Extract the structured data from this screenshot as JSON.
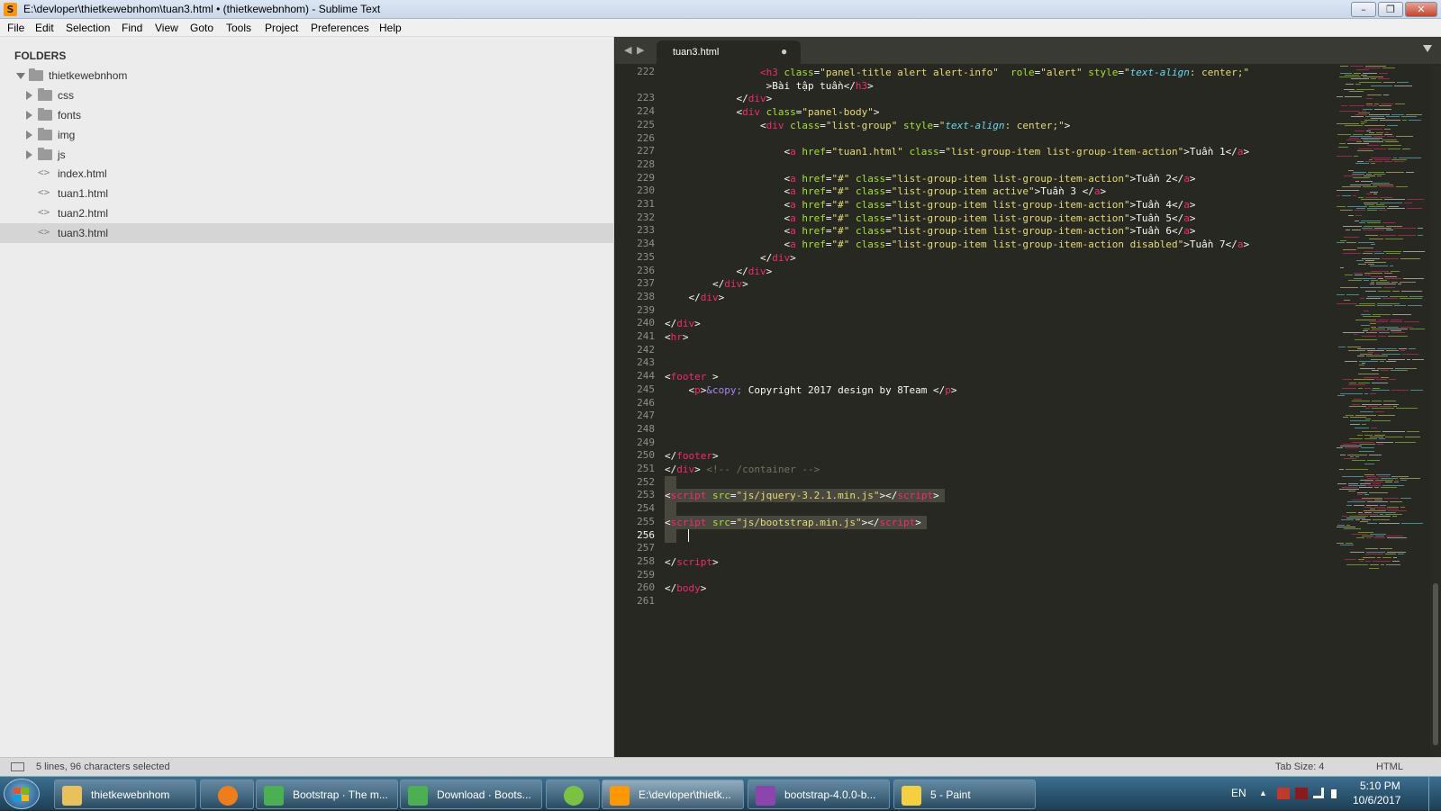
{
  "window": {
    "title": "E:\\devloper\\thietkewebnhom\\tuan3.html • (thietkewebnhom) - Sublime Text",
    "app_icon": "S",
    "minimize_icon": "–",
    "maximize_icon": "❐",
    "close_icon": "✕"
  },
  "menu": [
    "File",
    "Edit",
    "Selection",
    "Find",
    "View",
    "Goto",
    "Tools",
    "Project",
    "Preferences",
    "Help"
  ],
  "sidebar": {
    "header": "FOLDERS",
    "root": "thietkewebnhom",
    "folders": [
      "css",
      "fonts",
      "img",
      "js"
    ],
    "files": [
      "index.html",
      "tuan1.html",
      "tuan2.html",
      "tuan3.html"
    ],
    "selected_file": "tuan3.html",
    "file_icon": "<>"
  },
  "tabs": {
    "nav_left": "◀",
    "nav_right": "▶",
    "active": {
      "label": "tuan3.html",
      "dirty_marker": "●"
    }
  },
  "editor": {
    "current_line": 256,
    "lines": [
      {
        "n": 222,
        "html": "                <span class='t'>&lt;h3</span> <span class='a'>class</span>=<span class='s'>\"panel-title alert alert-info\"</span>  <span class='a'>role</span>=<span class='s'>\"alert\"</span> <span class='a'>style</span>=<span class='s'>\"<span class='i'>text-align</span>: center;\"</span>"
      },
      {
        "n": null,
        "html": "                 &gt;Bài tập tuần&lt;/<span class='t'>h3</span>&gt;"
      },
      {
        "n": 223,
        "html": "            &lt;/<span class='t'>div</span>&gt;"
      },
      {
        "n": 224,
        "html": "            &lt;<span class='t'>div</span> <span class='a'>class</span>=<span class='s'>\"panel-body\"</span>&gt;"
      },
      {
        "n": 225,
        "html": "                &lt;<span class='t'>div</span> <span class='a'>class</span>=<span class='s'>\"list-group\"</span> <span class='a'>style</span>=<span class='s'>\"<span class='i'>text-align</span>: center;\"</span>&gt;"
      },
      {
        "n": 226,
        "html": ""
      },
      {
        "n": 227,
        "html": "                    &lt;<span class='t'>a</span> <span class='a'>href</span>=<span class='s'>\"tuan1.html\"</span> <span class='a'>class</span>=<span class='s'>\"list-group-item list-group-item-action\"</span>&gt;Tuần 1&lt;/<span class='t'>a</span>&gt;"
      },
      {
        "n": 228,
        "html": ""
      },
      {
        "n": 229,
        "html": "                    &lt;<span class='t'>a</span> <span class='a'>href</span>=<span class='s'>\"#\"</span> <span class='a'>class</span>=<span class='s'>\"list-group-item list-group-item-action\"</span>&gt;Tuần 2&lt;/<span class='t'>a</span>&gt;"
      },
      {
        "n": 230,
        "html": "                    &lt;<span class='t'>a</span> <span class='a'>href</span>=<span class='s'>\"#\"</span> <span class='a'>class</span>=<span class='s'>\"list-group-item active\"</span>&gt;Tuần 3 &lt;/<span class='t'>a</span>&gt;"
      },
      {
        "n": 231,
        "html": "                    &lt;<span class='t'>a</span> <span class='a'>href</span>=<span class='s'>\"#\"</span> <span class='a'>class</span>=<span class='s'>\"list-group-item list-group-item-action\"</span>&gt;Tuần 4&lt;/<span class='t'>a</span>&gt;"
      },
      {
        "n": 232,
        "html": "                    &lt;<span class='t'>a</span> <span class='a'>href</span>=<span class='s'>\"#\"</span> <span class='a'>class</span>=<span class='s'>\"list-group-item list-group-item-action\"</span>&gt;Tuần 5&lt;/<span class='t'>a</span>&gt;"
      },
      {
        "n": 233,
        "html": "                    &lt;<span class='t'>a</span> <span class='a'>href</span>=<span class='s'>\"#\"</span> <span class='a'>class</span>=<span class='s'>\"list-group-item list-group-item-action\"</span>&gt;Tuần 6&lt;/<span class='t'>a</span>&gt;"
      },
      {
        "n": 234,
        "html": "                    &lt;<span class='t'>a</span> <span class='a'>href</span>=<span class='s'>\"#\"</span> <span class='a'>class</span>=<span class='s'>\"list-group-item list-group-item-action disabled\"</span>&gt;Tuần 7&lt;/<span class='t'>a</span>&gt;"
      },
      {
        "n": 235,
        "html": "                &lt;/<span class='t'>div</span>&gt;"
      },
      {
        "n": 236,
        "html": "            &lt;/<span class='t'>div</span>&gt;"
      },
      {
        "n": 237,
        "html": "        &lt;/<span class='t'>div</span>&gt;"
      },
      {
        "n": 238,
        "html": "    &lt;/<span class='t'>div</span>&gt;"
      },
      {
        "n": 239,
        "html": ""
      },
      {
        "n": 240,
        "html": "&lt;/<span class='t'>div</span>&gt;"
      },
      {
        "n": 241,
        "html": "&lt;<span class='t'>hr</span>&gt;"
      },
      {
        "n": 242,
        "html": ""
      },
      {
        "n": 243,
        "html": ""
      },
      {
        "n": 244,
        "html": "&lt;<span class='t'>footer</span> &gt;"
      },
      {
        "n": 245,
        "html": "    &lt;<span class='t'>p</span>&gt;<span class='e'>&amp;copy;</span> Copyright 2017 design by 8Team &lt;/<span class='t'>p</span>&gt;"
      },
      {
        "n": 246,
        "html": ""
      },
      {
        "n": 247,
        "html": ""
      },
      {
        "n": 248,
        "html": ""
      },
      {
        "n": 249,
        "html": ""
      },
      {
        "n": 250,
        "html": "&lt;/<span class='t'>footer</span>&gt;"
      },
      {
        "n": 251,
        "html": "&lt;/<span class='t'>div</span>&gt; <span class='c'>&lt;!-- /container --&gt;</span>"
      },
      {
        "n": 252,
        "html": ""
      },
      {
        "n": 253,
        "html": "&lt;<span class='t'>script</span> <span class='a'>src</span>=<span class='s'>\"js/jquery-3.2.1.min.js\"</span>&gt;&lt;/<span class='t'>script</span>&gt;"
      },
      {
        "n": 254,
        "html": ""
      },
      {
        "n": 255,
        "html": "&lt;<span class='t'>script</span> <span class='a'>src</span>=<span class='s'>\"js/bootstrap.min.js\"</span>&gt;&lt;/<span class='t'>script</span>&gt;"
      },
      {
        "n": 256,
        "html": ""
      },
      {
        "n": 257,
        "html": ""
      },
      {
        "n": 258,
        "html": "&lt;/<span class='t'>script</span>&gt;"
      },
      {
        "n": 259,
        "html": ""
      },
      {
        "n": 260,
        "html": "&lt;/<span class='t'>body</span>&gt;"
      },
      {
        "n": 261,
        "html": ""
      }
    ]
  },
  "status": {
    "text": "5 lines, 96 characters selected",
    "tab_size": "Tab Size: 4",
    "syntax": "HTML"
  },
  "taskbar": {
    "items": [
      {
        "label": "thietkewebnhom",
        "color": "#e8c15a"
      },
      {
        "label": "",
        "color": "#ef7d1a"
      },
      {
        "label": "Bootstrap · The m...",
        "color": "#4caf50"
      },
      {
        "label": "Download · Boots...",
        "color": "#4caf50"
      },
      {
        "label": "",
        "color": "#7cc242"
      },
      {
        "label": "E:\\devloper\\thietk...",
        "color": "#ff9800"
      },
      {
        "label": "bootstrap-4.0.0-b...",
        "color": "#8e44ad"
      },
      {
        "label": "5 - Paint",
        "color": "#f4d03f"
      }
    ],
    "lang": "EN",
    "tray_arrow": "▲",
    "clock_time": "5:10 PM",
    "clock_date": "10/6/2017"
  }
}
